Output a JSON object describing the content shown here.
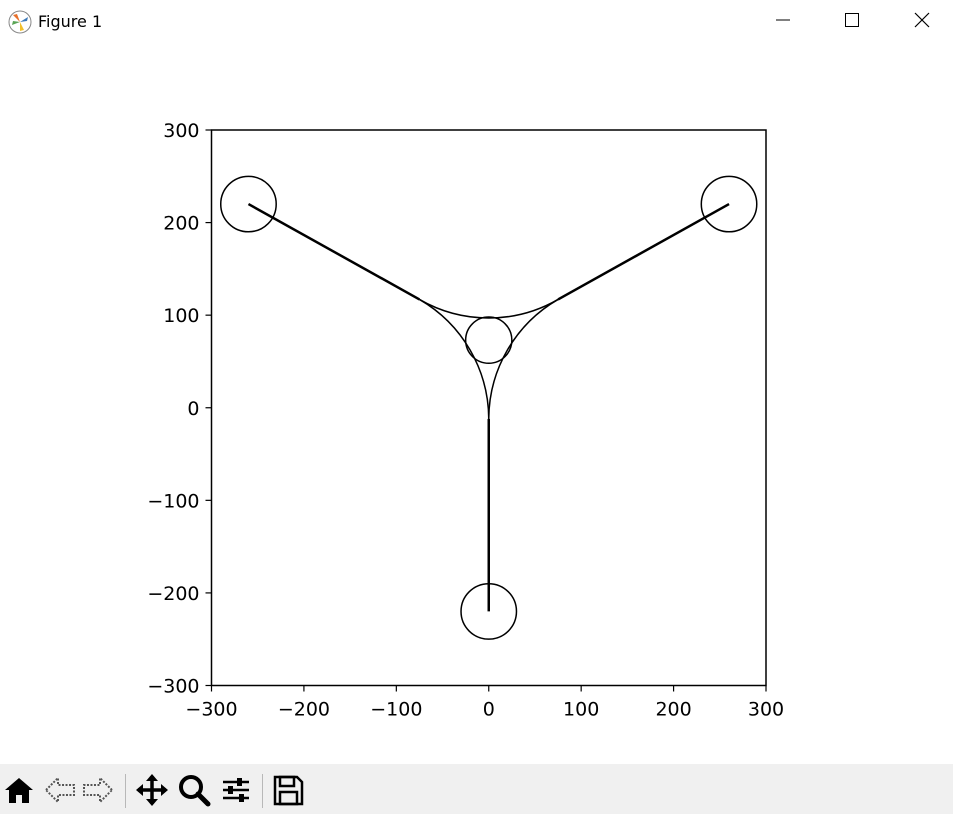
{
  "window": {
    "title": "Figure 1"
  },
  "icons": {
    "app": "matplotlib-icon",
    "minimize": "minimize-icon",
    "maximize": "maximize-icon",
    "close": "close-icon"
  },
  "toolbar": {
    "items": [
      "home-icon",
      "back-arrow-icon",
      "forward-arrow-icon",
      "pan-move-icon",
      "zoom-magnifier-icon",
      "configure-subplots-icon",
      "save-disk-icon"
    ]
  },
  "chart_data": {
    "type": "line",
    "title": "",
    "xlabel": "",
    "ylabel": "",
    "xlim": [
      -300,
      300
    ],
    "ylim": [
      -300,
      300
    ],
    "xticks": [
      -300,
      -200,
      -100,
      0,
      100,
      200,
      300
    ],
    "yticks": [
      -300,
      -200,
      -100,
      0,
      100,
      200,
      300
    ],
    "xtick_labels": [
      "−300",
      "−200",
      "−100",
      "0",
      "100",
      "200",
      "300"
    ],
    "ytick_labels": [
      "−300",
      "−200",
      "−100",
      "0",
      "100",
      "200",
      "300"
    ],
    "grid": false,
    "aspect": "equal",
    "line_color": "#000000",
    "circles": [
      {
        "center": [
          -260,
          220
        ],
        "r": 30
      },
      {
        "center": [
          260,
          220
        ],
        "r": 30
      },
      {
        "center": [
          0,
          -220
        ],
        "r": 30
      },
      {
        "center": [
          0,
          73
        ],
        "r": 25
      }
    ],
    "segments": [
      {
        "from": [
          -260,
          220
        ],
        "to": [
          -75,
          117
        ]
      },
      {
        "from": [
          260,
          220
        ],
        "to": [
          75,
          117
        ]
      },
      {
        "from": [
          0,
          -220
        ],
        "to": [
          0,
          -12
        ]
      }
    ],
    "arcs": [
      {
        "center": [
          0,
          248
        ],
        "r": 150,
        "from": [
          -75,
          117
        ],
        "to": [
          75,
          117
        ]
      },
      {
        "center": [
          -150,
          -12
        ],
        "r": 150,
        "from": [
          -75,
          117
        ],
        "to": [
          0,
          -12
        ]
      },
      {
        "center": [
          150,
          -12
        ],
        "r": 150,
        "from": [
          75,
          117
        ],
        "to": [
          0,
          -12
        ]
      }
    ]
  }
}
